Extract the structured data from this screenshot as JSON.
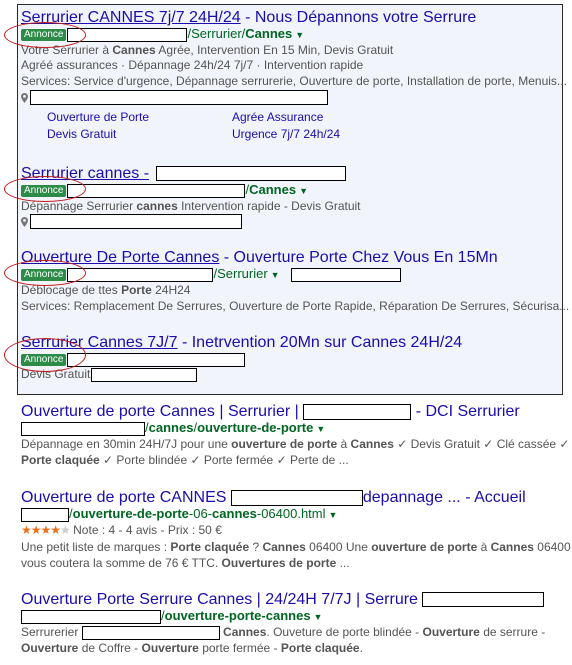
{
  "ad1": {
    "title_a": "Serrurier CANNES 7j/7 24H/24",
    "title_b": " - Nous Dépannons votre Serrure",
    "badge": "Annonce",
    "url_a": "/Serrurier/",
    "url_b": "Cannes",
    "desc1_a": "Votre Serrurier à ",
    "desc1_b": "Cannes",
    "desc1_c": " Agrée, Intervention En 15 Min, Devis Gratuit",
    "desc2": "Agréé assurances · Dépannage 24h/24 7j/7 · Intervention rapide",
    "desc3": "Services: Service d'urgence, Dépannage serrurerie, Ouverture de porte, Installation de porte, Menuis...",
    "sitelinks": [
      "Ouverture de Porte",
      "Agrée Assurance",
      "Devis Gratuit",
      "Urgence 7j/7 24h/24"
    ]
  },
  "ad2": {
    "title": "Serrurier cannes -",
    "badge": "Annonce",
    "url_a": "/",
    "url_b": "Cannes",
    "desc_a": "Dépannage Serrurier ",
    "desc_b": "cannes",
    "desc_c": " Intervention rapide - Devis Gratuit"
  },
  "ad3": {
    "title_a": "Ouverture De Porte Cannes",
    "title_b": " - Ouverture Porte Chez Vous En 15Mn",
    "badge": "Annonce",
    "url_a": "/Serrurier",
    "desc1_a": "Déblocage de ttes ",
    "desc1_b": "Porte",
    "desc1_c": " 24H24",
    "desc2": "Services: Remplacement De Serrures, Ouverture de Porte Rapide, Réparation De Serrures, Sécurisa..."
  },
  "ad4": {
    "title_a": "Serrurier Cannes 7J/7",
    "title_b": " - Inetrvention 20Mn sur Cannes 24H/24",
    "badge": "Annonce",
    "desc": "Devis Gratuit"
  },
  "res1": {
    "title_a": "Ouverture de porte Cannes | Serrurier |",
    "title_b": "- DCI Serrurier",
    "url_a": "/",
    "url_b": "cannes",
    "url_c": "/",
    "url_d": "ouverture-de-porte",
    "line1_a": "Dépannage en 30min 24H/7J pour une ",
    "line1_b": "ouverture de porte",
    "line1_c": " à ",
    "line1_d": "Cannes",
    "line1_e": " ✓ Devis Gratuit ✓ Clé cassée ✓",
    "line2_a": "Porte claquée",
    "line2_b": " ✓ Porte blindée ✓ Porte fermée ✓ Perte de ..."
  },
  "res2": {
    "title_a": "Ouverture de porte CANNES",
    "title_b": "depannage ... - Accueil",
    "url_a": "/",
    "url_b": "ouverture-de-porte",
    "url_c": "-06-",
    "url_d": "cannes",
    "url_e": "-06400.html",
    "stars": "★★★★",
    "star_empty": "★",
    "rating": 0.8,
    "rating_text": "Note : 4 - 4 avis - Prix : 50 €",
    "line1_a": "Une petit liste de marques : ",
    "line1_b": "Porte claquée",
    "line1_c": " ? ",
    "line1_d": "Cannes",
    "line1_e": " 06400 Une ",
    "line1_f": "ouverture de porte",
    "line1_g": " à ",
    "line1_h": "Cannes",
    "line1_i": " 06400",
    "line2_a": "vous coutera la somme de 76 € TTC. ",
    "line2_b": "Ouvertures de porte",
    "line2_c": " ..."
  },
  "res3": {
    "title": "Ouverture Porte Serrure Cannes | 24/24H 7/7J | Serrure",
    "url_a": "/",
    "url_b": "ouverture-porte-cannes",
    "line1_a": "Serrurerier",
    "line1_b": "Cannes",
    "line1_c": ". Ouveture de porte blindée - ",
    "line1_d": "Ouverture",
    "line1_e": " de serrure -",
    "line2_a": "Ouverture",
    "line2_b": " de Coffre - ",
    "line2_c": "Ouverture",
    "line2_d": " porte fermée - ",
    "line2_e": "Porte claquée",
    "line2_f": "."
  },
  "caret": "▼",
  "colors": {
    "title": "#1a0dab",
    "url": "#006621",
    "badge": "#2c8b47",
    "annotation": "#c21b1b",
    "ad_bg": "#f1f4fb"
  }
}
